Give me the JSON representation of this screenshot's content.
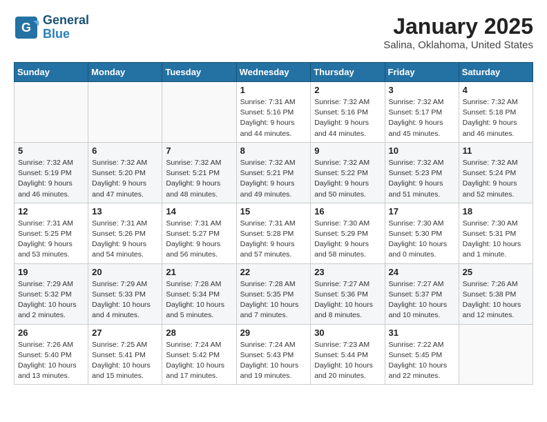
{
  "header": {
    "logo_general": "General",
    "logo_blue": "Blue",
    "month": "January 2025",
    "location": "Salina, Oklahoma, United States"
  },
  "days_of_week": [
    "Sunday",
    "Monday",
    "Tuesday",
    "Wednesday",
    "Thursday",
    "Friday",
    "Saturday"
  ],
  "weeks": [
    [
      {
        "day": "",
        "sunrise": "",
        "sunset": "",
        "daylight": ""
      },
      {
        "day": "",
        "sunrise": "",
        "sunset": "",
        "daylight": ""
      },
      {
        "day": "",
        "sunrise": "",
        "sunset": "",
        "daylight": ""
      },
      {
        "day": "1",
        "sunrise": "Sunrise: 7:31 AM",
        "sunset": "Sunset: 5:16 PM",
        "daylight": "Daylight: 9 hours and 44 minutes."
      },
      {
        "day": "2",
        "sunrise": "Sunrise: 7:32 AM",
        "sunset": "Sunset: 5:16 PM",
        "daylight": "Daylight: 9 hours and 44 minutes."
      },
      {
        "day": "3",
        "sunrise": "Sunrise: 7:32 AM",
        "sunset": "Sunset: 5:17 PM",
        "daylight": "Daylight: 9 hours and 45 minutes."
      },
      {
        "day": "4",
        "sunrise": "Sunrise: 7:32 AM",
        "sunset": "Sunset: 5:18 PM",
        "daylight": "Daylight: 9 hours and 46 minutes."
      }
    ],
    [
      {
        "day": "5",
        "sunrise": "Sunrise: 7:32 AM",
        "sunset": "Sunset: 5:19 PM",
        "daylight": "Daylight: 9 hours and 46 minutes."
      },
      {
        "day": "6",
        "sunrise": "Sunrise: 7:32 AM",
        "sunset": "Sunset: 5:20 PM",
        "daylight": "Daylight: 9 hours and 47 minutes."
      },
      {
        "day": "7",
        "sunrise": "Sunrise: 7:32 AM",
        "sunset": "Sunset: 5:21 PM",
        "daylight": "Daylight: 9 hours and 48 minutes."
      },
      {
        "day": "8",
        "sunrise": "Sunrise: 7:32 AM",
        "sunset": "Sunset: 5:21 PM",
        "daylight": "Daylight: 9 hours and 49 minutes."
      },
      {
        "day": "9",
        "sunrise": "Sunrise: 7:32 AM",
        "sunset": "Sunset: 5:22 PM",
        "daylight": "Daylight: 9 hours and 50 minutes."
      },
      {
        "day": "10",
        "sunrise": "Sunrise: 7:32 AM",
        "sunset": "Sunset: 5:23 PM",
        "daylight": "Daylight: 9 hours and 51 minutes."
      },
      {
        "day": "11",
        "sunrise": "Sunrise: 7:32 AM",
        "sunset": "Sunset: 5:24 PM",
        "daylight": "Daylight: 9 hours and 52 minutes."
      }
    ],
    [
      {
        "day": "12",
        "sunrise": "Sunrise: 7:31 AM",
        "sunset": "Sunset: 5:25 PM",
        "daylight": "Daylight: 9 hours and 53 minutes."
      },
      {
        "day": "13",
        "sunrise": "Sunrise: 7:31 AM",
        "sunset": "Sunset: 5:26 PM",
        "daylight": "Daylight: 9 hours and 54 minutes."
      },
      {
        "day": "14",
        "sunrise": "Sunrise: 7:31 AM",
        "sunset": "Sunset: 5:27 PM",
        "daylight": "Daylight: 9 hours and 56 minutes."
      },
      {
        "day": "15",
        "sunrise": "Sunrise: 7:31 AM",
        "sunset": "Sunset: 5:28 PM",
        "daylight": "Daylight: 9 hours and 57 minutes."
      },
      {
        "day": "16",
        "sunrise": "Sunrise: 7:30 AM",
        "sunset": "Sunset: 5:29 PM",
        "daylight": "Daylight: 9 hours and 58 minutes."
      },
      {
        "day": "17",
        "sunrise": "Sunrise: 7:30 AM",
        "sunset": "Sunset: 5:30 PM",
        "daylight": "Daylight: 10 hours and 0 minutes."
      },
      {
        "day": "18",
        "sunrise": "Sunrise: 7:30 AM",
        "sunset": "Sunset: 5:31 PM",
        "daylight": "Daylight: 10 hours and 1 minute."
      }
    ],
    [
      {
        "day": "19",
        "sunrise": "Sunrise: 7:29 AM",
        "sunset": "Sunset: 5:32 PM",
        "daylight": "Daylight: 10 hours and 2 minutes."
      },
      {
        "day": "20",
        "sunrise": "Sunrise: 7:29 AM",
        "sunset": "Sunset: 5:33 PM",
        "daylight": "Daylight: 10 hours and 4 minutes."
      },
      {
        "day": "21",
        "sunrise": "Sunrise: 7:28 AM",
        "sunset": "Sunset: 5:34 PM",
        "daylight": "Daylight: 10 hours and 5 minutes."
      },
      {
        "day": "22",
        "sunrise": "Sunrise: 7:28 AM",
        "sunset": "Sunset: 5:35 PM",
        "daylight": "Daylight: 10 hours and 7 minutes."
      },
      {
        "day": "23",
        "sunrise": "Sunrise: 7:27 AM",
        "sunset": "Sunset: 5:36 PM",
        "daylight": "Daylight: 10 hours and 8 minutes."
      },
      {
        "day": "24",
        "sunrise": "Sunrise: 7:27 AM",
        "sunset": "Sunset: 5:37 PM",
        "daylight": "Daylight: 10 hours and 10 minutes."
      },
      {
        "day": "25",
        "sunrise": "Sunrise: 7:26 AM",
        "sunset": "Sunset: 5:38 PM",
        "daylight": "Daylight: 10 hours and 12 minutes."
      }
    ],
    [
      {
        "day": "26",
        "sunrise": "Sunrise: 7:26 AM",
        "sunset": "Sunset: 5:40 PM",
        "daylight": "Daylight: 10 hours and 13 minutes."
      },
      {
        "day": "27",
        "sunrise": "Sunrise: 7:25 AM",
        "sunset": "Sunset: 5:41 PM",
        "daylight": "Daylight: 10 hours and 15 minutes."
      },
      {
        "day": "28",
        "sunrise": "Sunrise: 7:24 AM",
        "sunset": "Sunset: 5:42 PM",
        "daylight": "Daylight: 10 hours and 17 minutes."
      },
      {
        "day": "29",
        "sunrise": "Sunrise: 7:24 AM",
        "sunset": "Sunset: 5:43 PM",
        "daylight": "Daylight: 10 hours and 19 minutes."
      },
      {
        "day": "30",
        "sunrise": "Sunrise: 7:23 AM",
        "sunset": "Sunset: 5:44 PM",
        "daylight": "Daylight: 10 hours and 20 minutes."
      },
      {
        "day": "31",
        "sunrise": "Sunrise: 7:22 AM",
        "sunset": "Sunset: 5:45 PM",
        "daylight": "Daylight: 10 hours and 22 minutes."
      },
      {
        "day": "",
        "sunrise": "",
        "sunset": "",
        "daylight": ""
      }
    ]
  ]
}
